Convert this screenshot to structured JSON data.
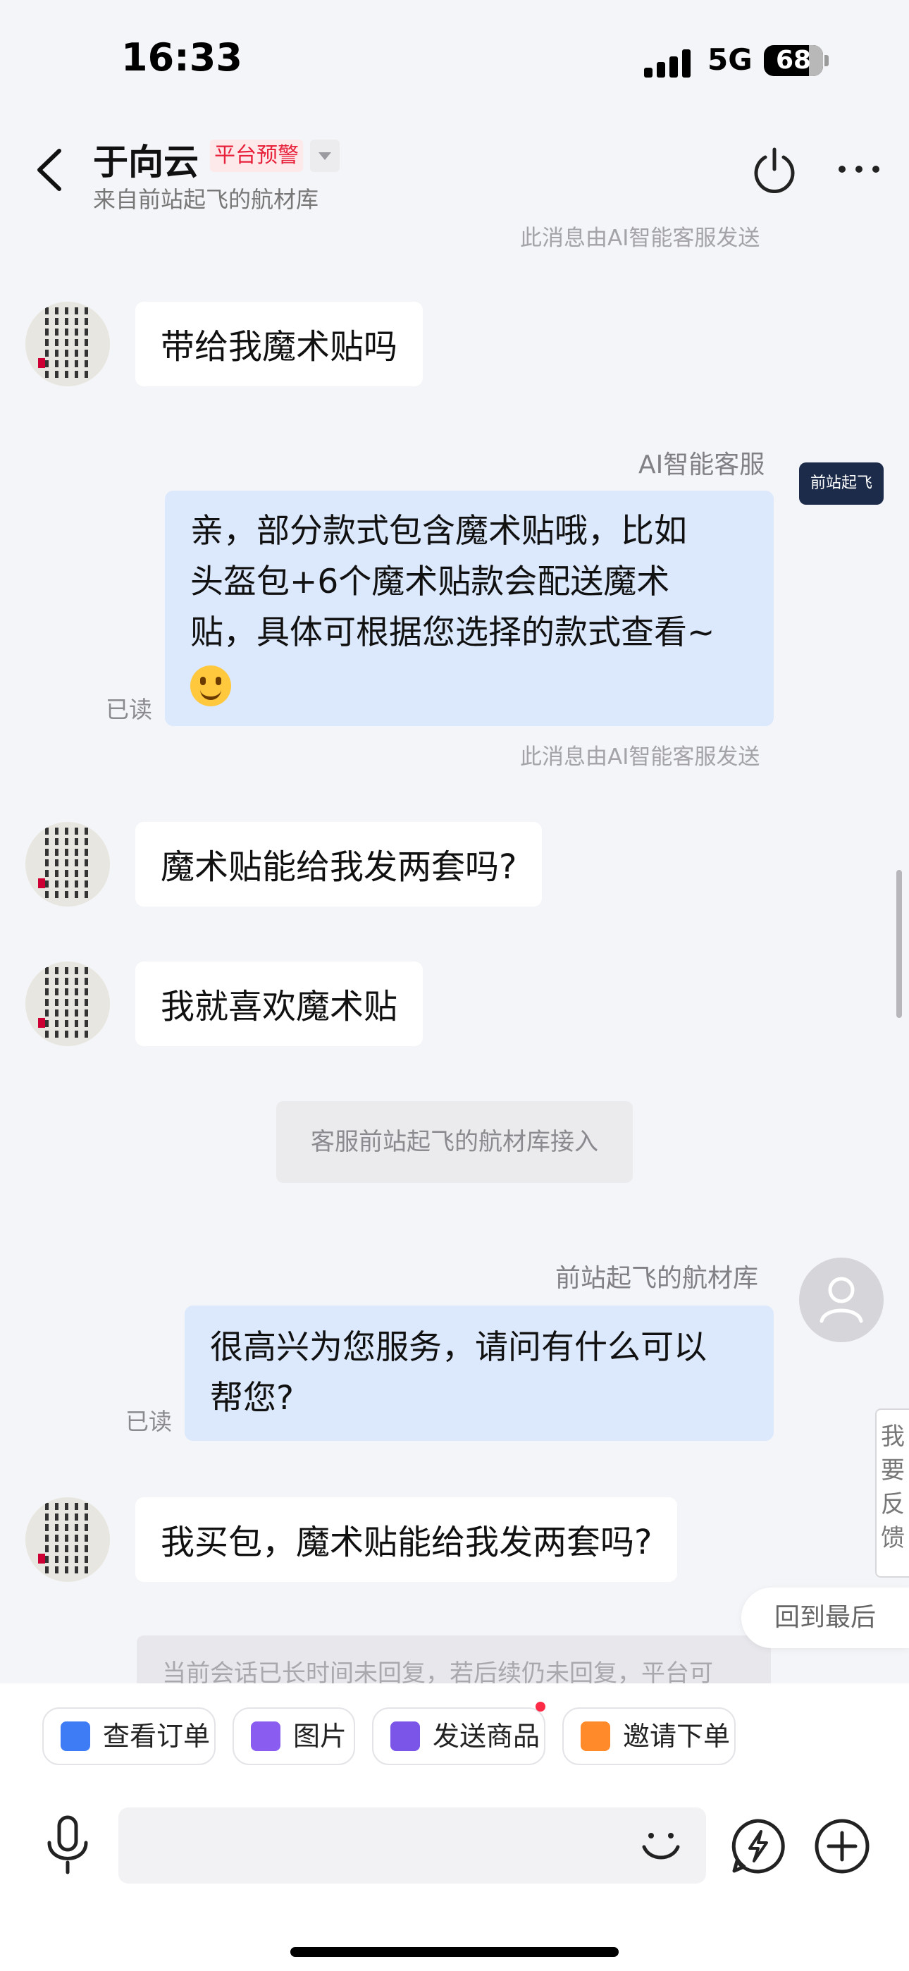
{
  "status_bar": {
    "time": "16:33",
    "network": "5G",
    "battery": "68"
  },
  "header": {
    "contact_name": "于向云",
    "warning_badge": "平台预警",
    "subtitle": "来自前站起飞的航材库"
  },
  "chat": {
    "ai_notice_top": "此消息由AI智能客服发送",
    "msg1": "带给我魔术贴吗",
    "ai_sender": "AI智能客服",
    "ai_avatar_text": "前站起飞",
    "ai_reply_lines": [
      "亲，部分款式包含魔术贴哦，比如",
      "头盔包+6个魔术贴款会配送魔术",
      "贴，具体可根据您选择的款式查看~"
    ],
    "ai_reply_emoji": "smiling-face",
    "read_label": "已读",
    "ai_notice_2": "此消息由AI智能客服发送",
    "msg2": "魔术贴能给我发两套吗?",
    "msg3": "我就喜欢魔术贴",
    "system_message": "客服前站起飞的航材库接入",
    "agent_sender": "前站起飞的航材库",
    "agent_reply_lines": [
      "很高兴为您服务，请问有什么可以",
      "帮您?"
    ],
    "read_label_2": "已读",
    "msg4": "我买包，魔术贴能给我发两套吗?",
    "timeout_notice": "当前会话已长时间未回复，若后续仍未回复，平台可",
    "feedback_label": "我要反馈",
    "back_to_latest": "回到最后"
  },
  "quick_actions": [
    {
      "label": "查看订单",
      "icon": "order-icon",
      "color": "#3d7cf5"
    },
    {
      "label": "图片",
      "icon": "image-icon",
      "color": "#8a5cf0"
    },
    {
      "label": "发送商品",
      "icon": "bag-icon",
      "color": "#7b54e8",
      "badge": true
    },
    {
      "label": "邀请下单",
      "icon": "invite-icon",
      "color": "#ff8a2a"
    }
  ],
  "colors": {
    "accent_red": "#e8213b",
    "bubble_out": "#dce8fb",
    "bubble_in": "#ffffff",
    "background": "#f4f5f8"
  }
}
